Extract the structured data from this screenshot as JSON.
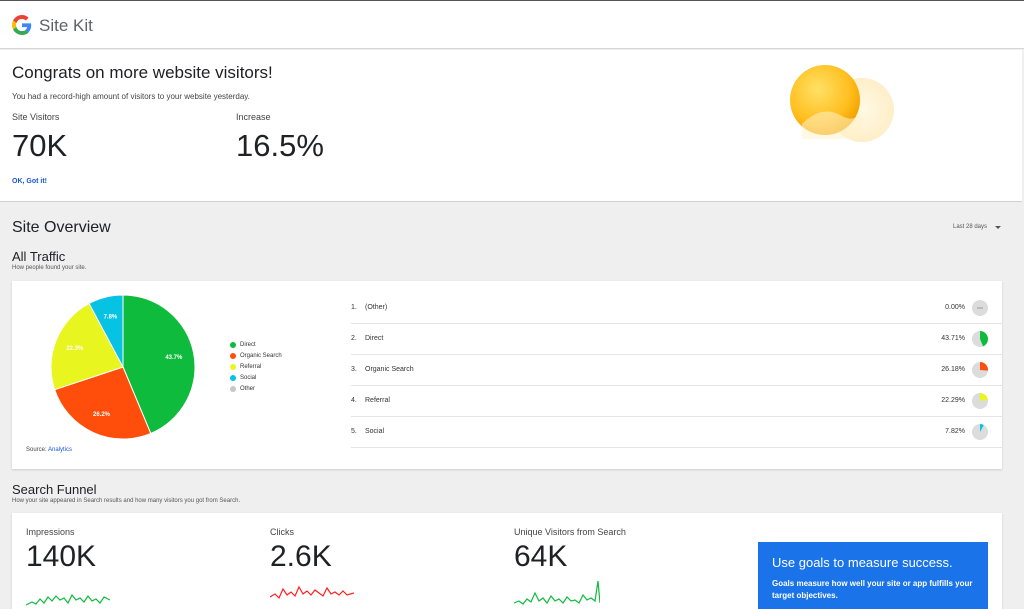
{
  "app": {
    "name": "Site Kit",
    "logo_icon": "google-g-icon"
  },
  "banner": {
    "title": "Congrats on more website visitors!",
    "subtitle": "You had a record-high amount of visitors to your website yesterday.",
    "stats": [
      {
        "label": "Site Visitors",
        "value": "70K"
      },
      {
        "label": "Increase",
        "value": "16.5%"
      }
    ],
    "action_label": "OK, Got it!"
  },
  "overview": {
    "title": "Site Overview",
    "date_range": "Last 28 days"
  },
  "traffic": {
    "title": "All Traffic",
    "description": "How people found your site.",
    "source_prefix": "Source:",
    "source_link": "Analytics",
    "legend": [
      {
        "label": "Direct",
        "color": "#0fbb3d"
      },
      {
        "label": "Organic Search",
        "color": "#ff4e0b"
      },
      {
        "label": "Referral",
        "color": "#e8f51e"
      },
      {
        "label": "Social",
        "color": "#06c3e3"
      },
      {
        "label": "Other",
        "color": "#c7c7c7"
      }
    ],
    "rows": [
      {
        "rank": "1.",
        "name": "(Other)",
        "pct": "0.00%",
        "value": 0.0,
        "color": "#c7c7c7"
      },
      {
        "rank": "2.",
        "name": "Direct",
        "pct": "43.71%",
        "value": 43.71,
        "color": "#0fbb3d"
      },
      {
        "rank": "3.",
        "name": "Organic Search",
        "pct": "26.18%",
        "value": 26.18,
        "color": "#ff4e0b"
      },
      {
        "rank": "4.",
        "name": "Referral",
        "pct": "22.29%",
        "value": 22.29,
        "color": "#e8f51e"
      },
      {
        "rank": "5.",
        "name": "Social",
        "pct": "7.82%",
        "value": 7.82,
        "color": "#06c3e3"
      }
    ]
  },
  "chart_data": {
    "type": "pie",
    "categories": [
      "Direct",
      "Organic Search",
      "Referral",
      "Social"
    ],
    "values": [
      43.7,
      26.2,
      22.3,
      7.8
    ],
    "labels": [
      "43.7%",
      "26.2%",
      "22.3%",
      "7.8%"
    ],
    "colors": [
      "#0fbb3d",
      "#ff4e0b",
      "#e8f51e",
      "#06c3e3"
    ],
    "legend": "right"
  },
  "funnel": {
    "title": "Search Funnel",
    "description": "How your site appeared in Search results and how many visitors you got from Search.",
    "metrics": [
      {
        "label": "Impressions",
        "value": "140K",
        "color": "#0fbb3d"
      },
      {
        "label": "Clicks",
        "value": "2.6K",
        "color": "#ff1f1f"
      },
      {
        "label": "Unique Visitors from Search",
        "value": "64K",
        "color": "#0fbb3d"
      }
    ],
    "goals": {
      "title": "Use goals to measure success.",
      "text": "Goals measure how well your site or app fulfills your target objectives."
    }
  }
}
